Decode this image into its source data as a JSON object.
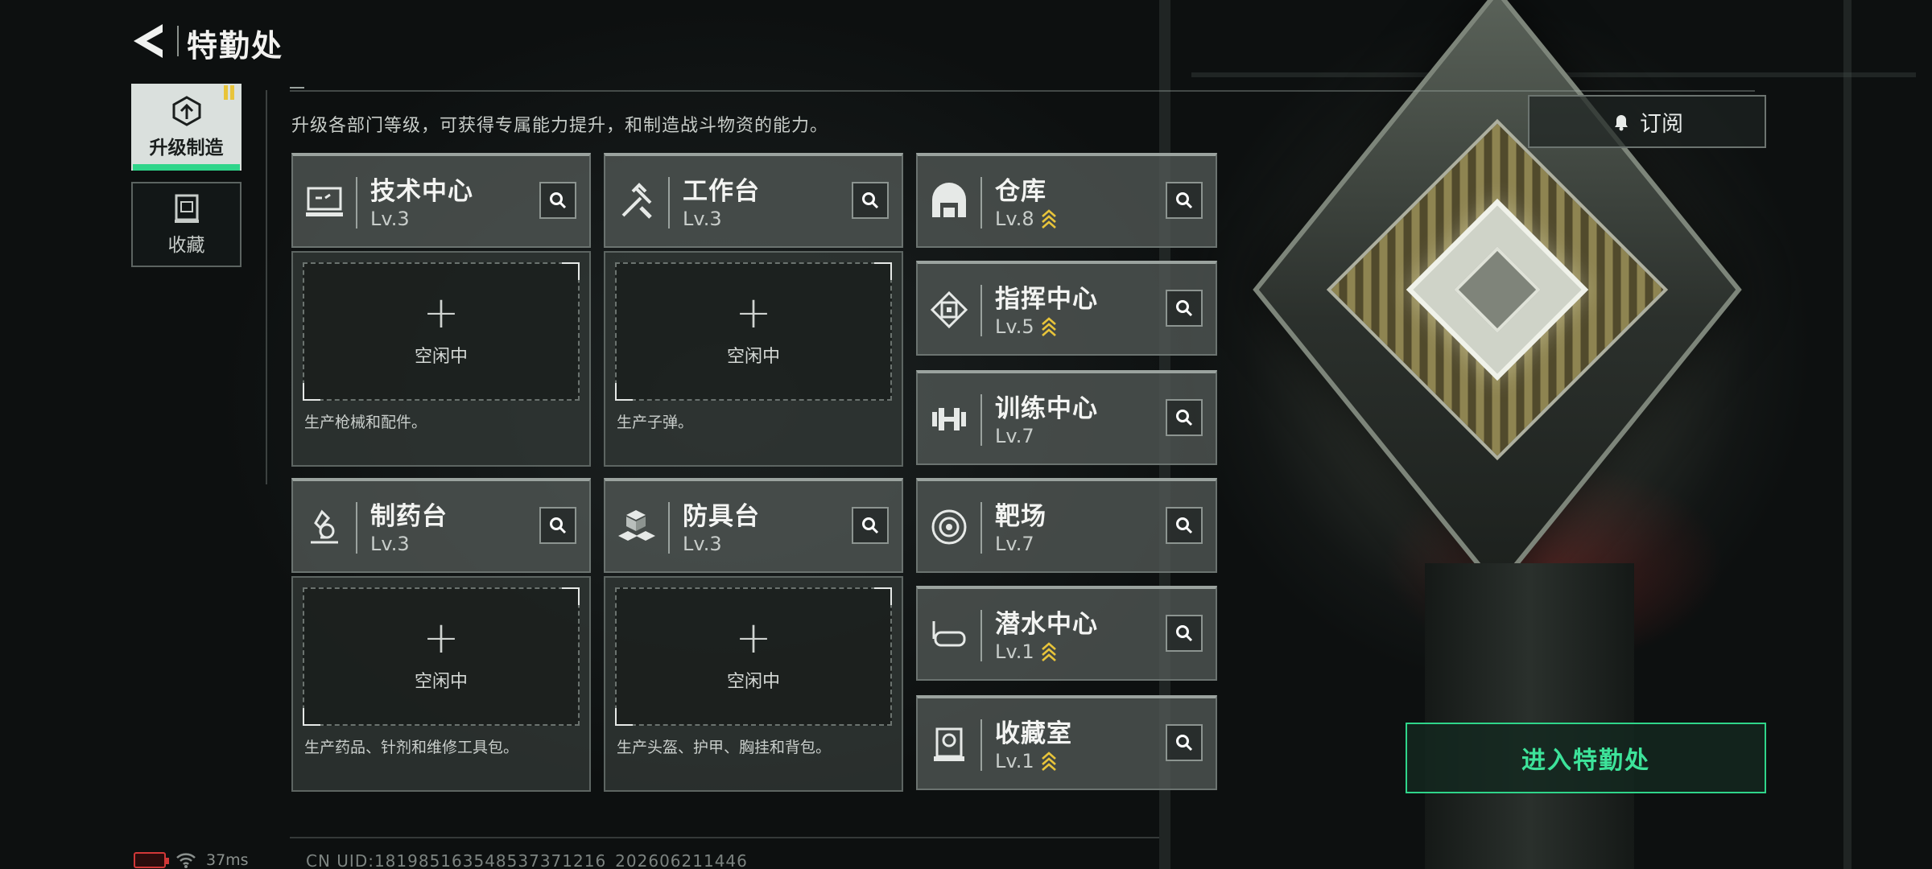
{
  "header": {
    "title": "特勤处"
  },
  "nav": {
    "items": [
      {
        "label": "升级制造",
        "icon": "upgrade-icon",
        "active": true
      },
      {
        "label": "收藏",
        "icon": "collection-icon",
        "active": false
      }
    ]
  },
  "description": "升级各部门等级，可获得专属能力提升，和制造战斗物资的能力。",
  "subscribe_label": "订阅",
  "workstations": [
    {
      "name": "技术中心",
      "level": "Lv.3",
      "slot_label": "空闲中",
      "slot_desc": "生产枪械和配件。",
      "icon": "monitor-icon"
    },
    {
      "name": "工作台",
      "level": "Lv.3",
      "slot_label": "空闲中",
      "slot_desc": "生产子弹。",
      "icon": "tools-icon"
    },
    {
      "name": "制药台",
      "level": "Lv.3",
      "slot_label": "空闲中",
      "slot_desc": "生产药品、针剂和维修工具包。",
      "icon": "microscope-icon"
    },
    {
      "name": "防具台",
      "level": "Lv.3",
      "slot_label": "空闲中",
      "slot_desc": "生产头盔、护甲、胸挂和背包。",
      "icon": "armor-blocks-icon"
    }
  ],
  "departments": [
    {
      "name": "仓库",
      "level": "Lv.8",
      "upgradeable": true,
      "icon": "warehouse-icon"
    },
    {
      "name": "指挥中心",
      "level": "Lv.5",
      "upgradeable": true,
      "icon": "chip-icon"
    },
    {
      "name": "训练中心",
      "level": "Lv.7",
      "upgradeable": false,
      "icon": "dumbbell-icon"
    },
    {
      "name": "靶场",
      "level": "Lv.7",
      "upgradeable": false,
      "icon": "target-icon"
    },
    {
      "name": "潜水中心",
      "level": "Lv.1",
      "upgradeable": true,
      "icon": "diving-mask-icon"
    },
    {
      "name": "收藏室",
      "level": "Lv.1",
      "upgradeable": true,
      "icon": "vault-icon"
    }
  ],
  "enter_label": "进入特勤处",
  "status": {
    "ping": "37ms",
    "uid": "CN UID:1819851635485373712​16_202606211446"
  },
  "colors": {
    "accent": "#2fd58a",
    "rank_up": "#e8c43a",
    "battery": "#d23838"
  }
}
